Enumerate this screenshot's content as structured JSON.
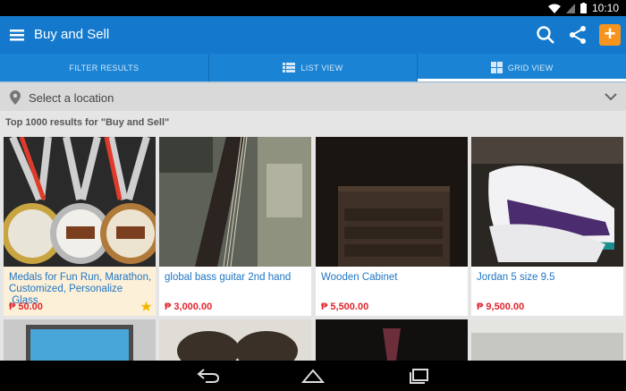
{
  "status": {
    "time": "10:10"
  },
  "app": {
    "title": "Buy and Sell",
    "add_label": "+"
  },
  "tabs": [
    {
      "label": "FILTER RESULTS"
    },
    {
      "label": "LIST VIEW"
    },
    {
      "label": "GRID VIEW"
    }
  ],
  "location": {
    "label": "Select a location"
  },
  "results_text": "Top 1000 results for \"Buy and Sell\"",
  "listings": [
    {
      "name": "Medals for Fun Run, Marathon, Customized, Personalize ,Glass",
      "price": "₱ 50.00"
    },
    {
      "name": "global bass guitar 2nd hand",
      "price": "₱ 3,000.00"
    },
    {
      "name": "Wooden Cabinet",
      "price": "₱ 5,500.00"
    },
    {
      "name": "Jordan 5 size 9.5",
      "price": "₱ 9,500.00"
    }
  ],
  "colors": {
    "appbar": "#1479cc",
    "tabs": "#1a83d4",
    "accent": "#f7941d",
    "price": "#e0252d",
    "link": "#1f75c4"
  }
}
